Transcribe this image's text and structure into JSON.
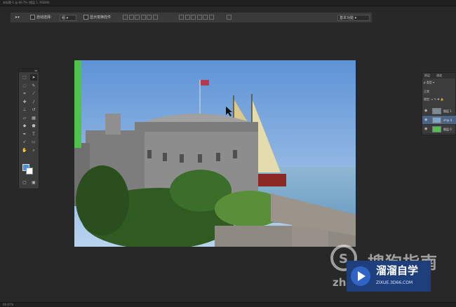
{
  "window": {
    "tab_title": "未标题-1 @ 66.7% (图层 1, RGB/8)",
    "status_text": "66.67%"
  },
  "options_bar": {
    "move_tool_icon": "move-arrow-icon",
    "auto_select_label": "自动选择:",
    "auto_select_value": "组",
    "show_transform_label": "显示变换控件",
    "workspace_value": "基本功能"
  },
  "toolbox": {
    "collapse_label": "◂◂",
    "tools": [
      {
        "name": "marquee-tool",
        "glyph": "⬚"
      },
      {
        "name": "move-tool",
        "glyph": "➤"
      },
      {
        "name": "lasso-tool",
        "glyph": "◌"
      },
      {
        "name": "quick-select-tool",
        "glyph": "✎"
      },
      {
        "name": "crop-tool",
        "glyph": "⌗"
      },
      {
        "name": "eyedropper-tool",
        "glyph": "⁄"
      },
      {
        "name": "healing-tool",
        "glyph": "✚"
      },
      {
        "name": "brush-tool",
        "glyph": "∕"
      },
      {
        "name": "stamp-tool",
        "glyph": "⊥"
      },
      {
        "name": "history-brush-tool",
        "glyph": "↺"
      },
      {
        "name": "eraser-tool",
        "glyph": "▱"
      },
      {
        "name": "gradient-tool",
        "glyph": "▦"
      },
      {
        "name": "blur-tool",
        "glyph": "◆"
      },
      {
        "name": "dodge-tool",
        "glyph": "●"
      },
      {
        "name": "pen-tool",
        "glyph": "✒"
      },
      {
        "name": "type-tool",
        "glyph": "T"
      },
      {
        "name": "path-select-tool",
        "glyph": "➶"
      },
      {
        "name": "shape-tool",
        "glyph": "▭"
      },
      {
        "name": "hand-tool",
        "glyph": "✋"
      },
      {
        "name": "zoom-tool",
        "glyph": "⌕"
      }
    ],
    "foreground_color": "#4a90d9",
    "background_color": "#ffffff"
  },
  "layers_panel": {
    "tab_layers": "图层",
    "tab_channels": "通道",
    "filter_value": "类型",
    "blend_mode": "正常",
    "lock_label": "锁定:",
    "layers": [
      {
        "name": "图层 1",
        "thumb": "castle",
        "visible": true,
        "selected": false
      },
      {
        "name": "ship-4",
        "thumb": "ship",
        "visible": true,
        "selected": true
      },
      {
        "name": "图层 0",
        "thumb": "green",
        "visible": true,
        "selected": false
      }
    ]
  },
  "watermarks": {
    "sogou_cn": "搜狗指南",
    "sogou_domain": "zh",
    "brand_cn": "溜溜自学",
    "brand_url": "ZIXUE.3D66.COM"
  },
  "colors": {
    "app_bg": "#282828",
    "panel_bg": "#3c3c3c",
    "accent_green": "#4ec24a",
    "selection_blue": "#4b6384"
  }
}
